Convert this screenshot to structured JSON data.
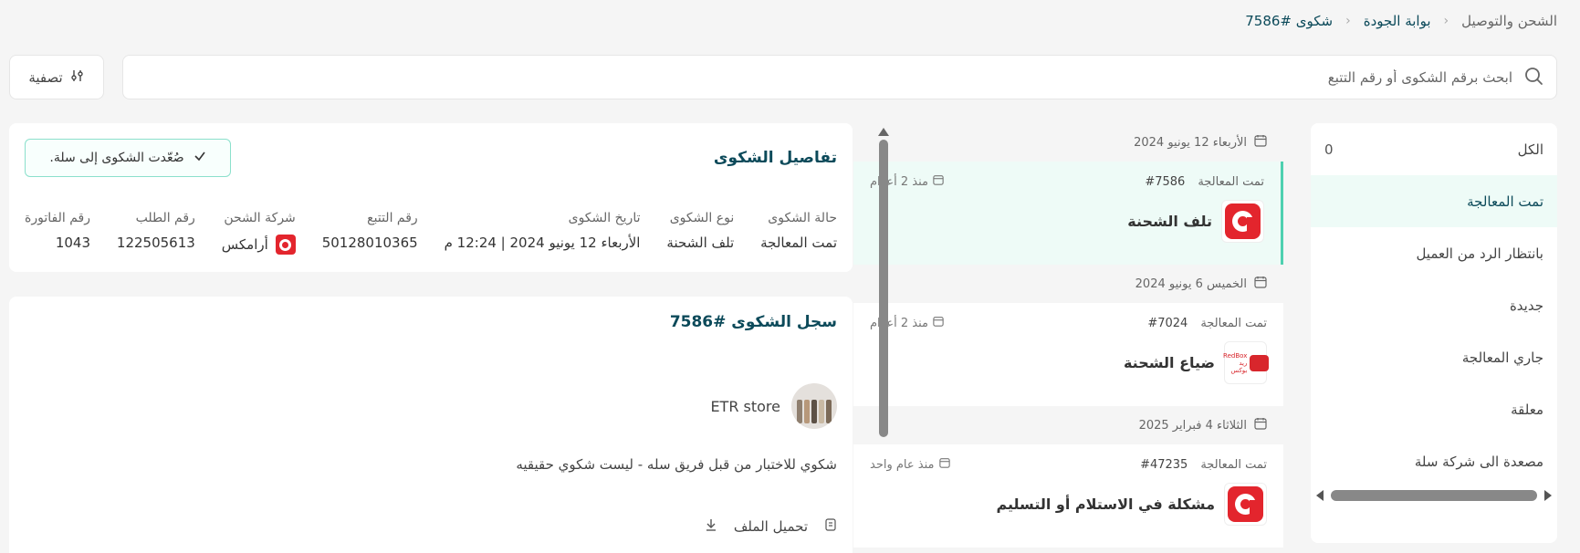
{
  "breadcrumb": {
    "items": [
      "الشحن والتوصيل",
      "بوابة الجودة",
      "شكوى #7586"
    ]
  },
  "search": {
    "placeholder": "ابحث برقم الشكوى أو رقم التتبع"
  },
  "filter": {
    "label": "تصفية"
  },
  "status_panel": {
    "items": [
      {
        "label": "الكل",
        "count": "0"
      },
      {
        "label": "تمت المعالجة",
        "count": ""
      },
      {
        "label": "بانتظار الرد من العميل",
        "count": ""
      },
      {
        "label": "جديدة",
        "count": ""
      },
      {
        "label": "جاري المعالجة",
        "count": ""
      },
      {
        "label": "معلقة",
        "count": ""
      },
      {
        "label": "مصعدة الى شركة سلة",
        "count": ""
      }
    ],
    "active_index": 1
  },
  "complaint_list": {
    "groups": [
      {
        "date": "الأربعاء 12 يونيو 2024",
        "cards": [
          {
            "status": "تمت المعالجة",
            "number": "#7586",
            "age": "منذ 2 أعوام",
            "title": "تلف الشحنة",
            "carrier": "aramex"
          }
        ]
      },
      {
        "date": "الخميس 6 يونيو 2024",
        "cards": [
          {
            "status": "تمت المعالجة",
            "number": "#7024",
            "age": "منذ 2 أعوام",
            "title": "ضياع الشحنة",
            "carrier": "redbox"
          }
        ]
      },
      {
        "date": "الثلاثاء 4 فبراير 2025",
        "cards": [
          {
            "status": "تمت المعالجة",
            "number": "#47235",
            "age": "منذ عام واحد",
            "title": "مشكلة في الاستلام أو التسليم",
            "carrier": "aramex"
          }
        ]
      }
    ],
    "redbox_text": [
      "RedBox",
      "ريد بوكس"
    ]
  },
  "details": {
    "title": "تفاصيل الشكوى",
    "escalated_badge": "صُعّدت الشكوى إلى سلة.",
    "fields": [
      {
        "label": "حالة الشكوى",
        "value": "تمت المعالجة"
      },
      {
        "label": "نوع الشكوى",
        "value": "تلف الشحنة"
      },
      {
        "label": "تاريخ الشكوى",
        "value": "الأربعاء 12 يونيو 2024 | 12:24 م"
      },
      {
        "label": "رقم التتبع",
        "value": "50128010365"
      },
      {
        "label": "شركة الشحن",
        "value": "أرامكس"
      },
      {
        "label": "رقم الطلب",
        "value": "122505613"
      },
      {
        "label": "رقم الفاتورة",
        "value": "1043"
      }
    ]
  },
  "log": {
    "title": "سجل الشكوى #7586",
    "author": "ETR store",
    "text": "شكوي للاختبار من قبل فريق سله - ليست شكوي حقيقيه",
    "download_label": "تحميل الملف"
  },
  "colors": {
    "accent": "#0c4a5a",
    "active_bg": "#eefbf7",
    "active_border": "#4ed0b0",
    "aramex_red": "#e3252d"
  },
  "icons": {
    "search": "search-icon",
    "filter": "sliders-icon",
    "calendar": "calendar-icon",
    "check": "check-icon",
    "download": "download-icon",
    "file": "file-icon",
    "chevron": "chevron-left-icon"
  }
}
